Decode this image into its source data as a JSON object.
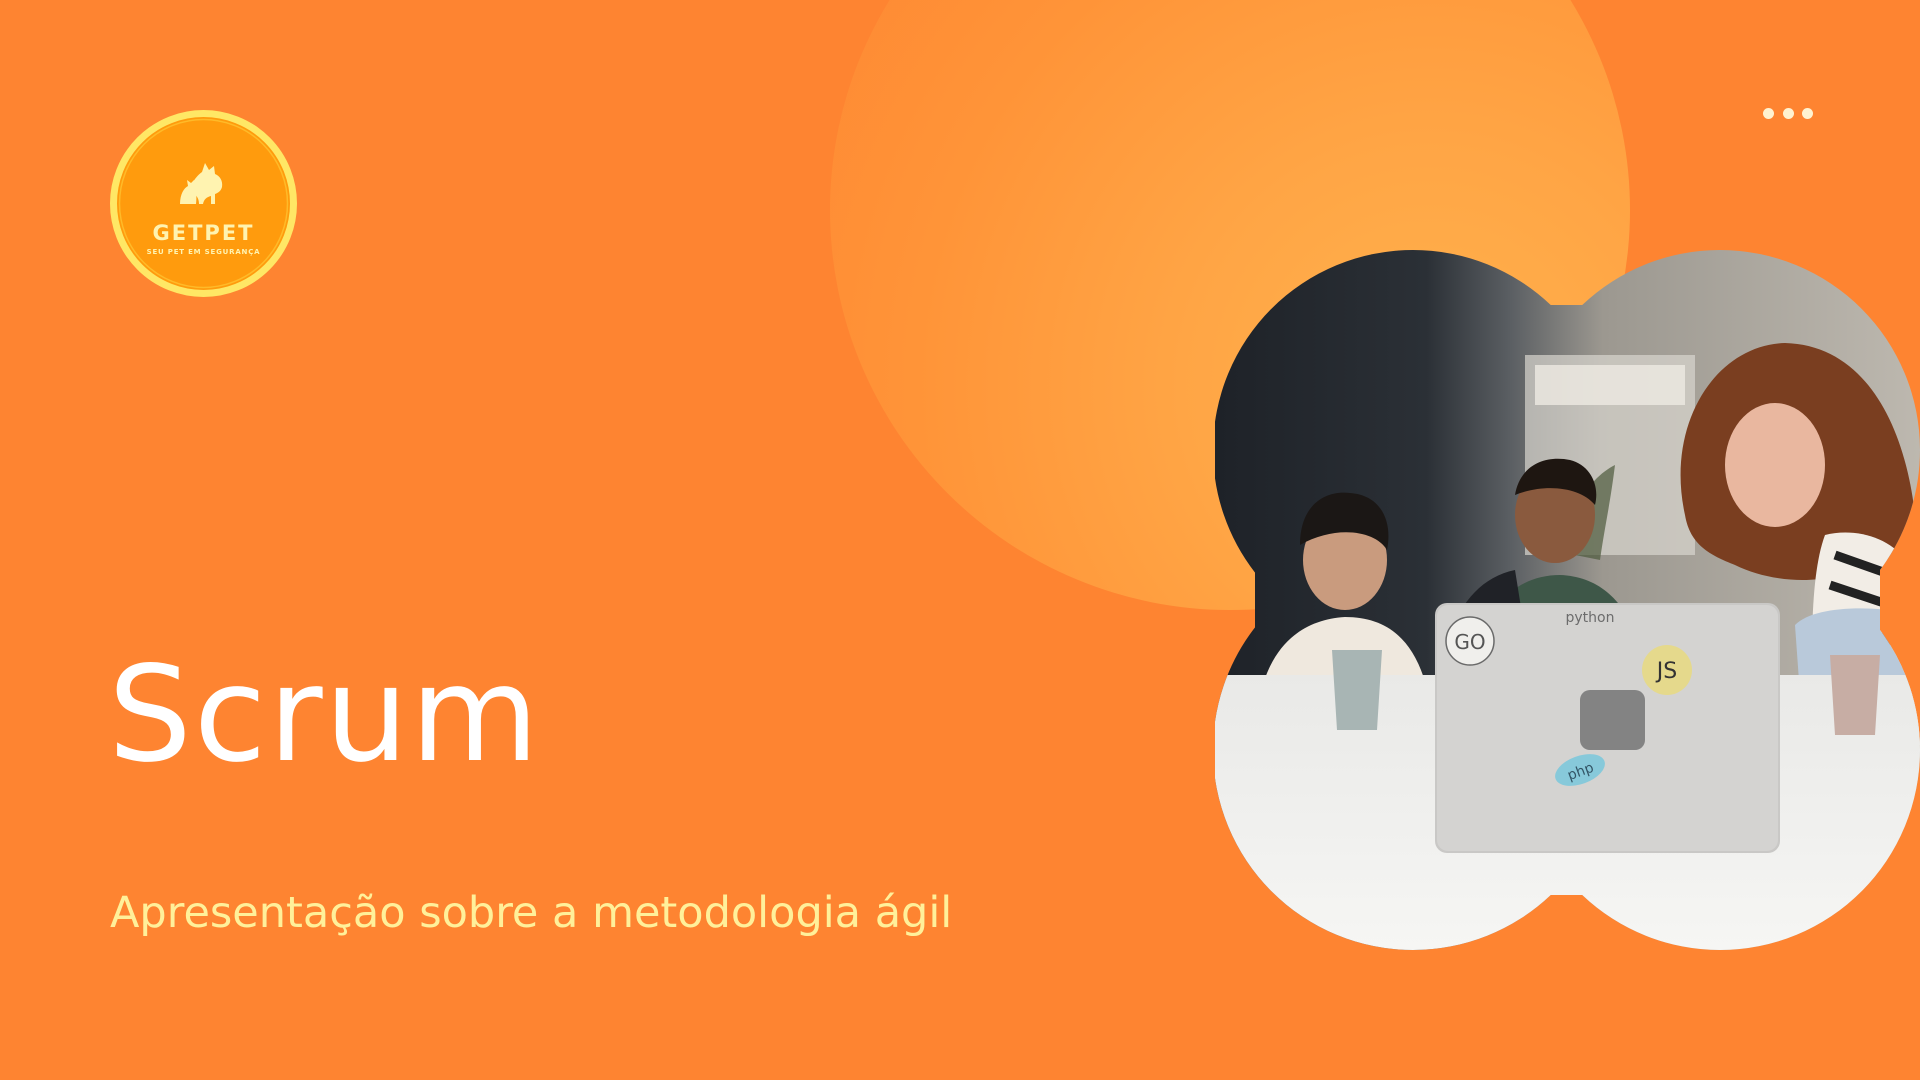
{
  "slide": {
    "title": "Scrum",
    "subtitle": "Apresentação sobre a metodologia ágil"
  },
  "logo": {
    "brand": "GETPET",
    "tagline": "SEU PET EM SEGURANÇA",
    "icon": "dog-cat-icon"
  },
  "menu": {
    "icon": "more-horizontal-icon"
  },
  "photo": {
    "description_icon": "team-meeting-photo",
    "laptop_stickers": [
      "GO",
      "python",
      "JS",
      "php"
    ]
  },
  "colors": {
    "background": "#FE8431",
    "accent_circle": "#FFB24D",
    "title": "#FFFFFF",
    "subtitle": "#FFF09A",
    "logo_fill": "#FF9B0D",
    "logo_ring": "#FFE765"
  }
}
